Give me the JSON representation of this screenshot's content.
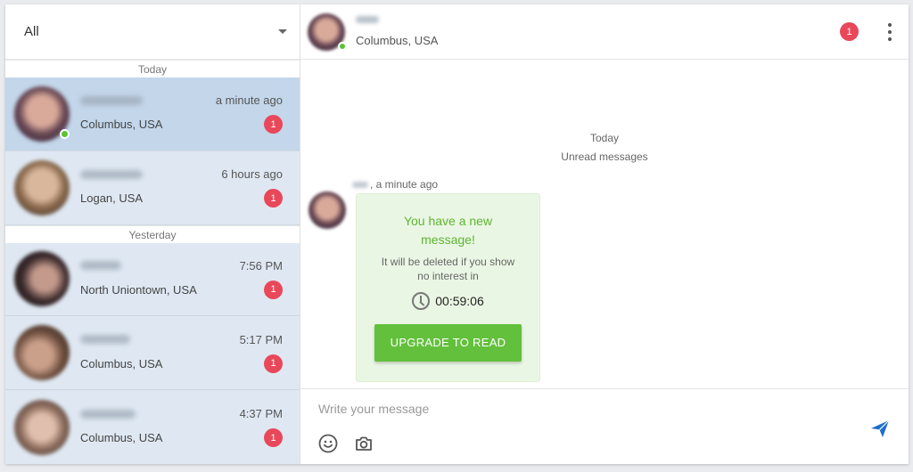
{
  "sidebar": {
    "filter": {
      "value": "All"
    },
    "sections": [
      {
        "label": "Today"
      },
      {
        "label": "Yesterday"
      }
    ],
    "conversations": [
      {
        "time": "a minute ago",
        "location": "Columbus, USA",
        "unread": "1",
        "online": true,
        "avatar_color": "#8a6470"
      },
      {
        "time": "6 hours ago",
        "location": "Logan, USA",
        "unread": "1",
        "online": false,
        "avatar_color": "#7a6a58"
      },
      {
        "time": "7:56 PM",
        "location": "North Uniontown, USA",
        "unread": "1",
        "online": false,
        "avatar_color": "#3e2e30"
      },
      {
        "time": "5:17 PM",
        "location": "Columbus, USA",
        "unread": "1",
        "online": false,
        "avatar_color": "#6e5244"
      },
      {
        "time": "4:37 PM",
        "location": "Columbus, USA",
        "unread": "1",
        "online": false,
        "avatar_color": "#8f7060"
      }
    ]
  },
  "chat": {
    "header": {
      "location": "Columbus, USA",
      "unread": "1"
    },
    "day_label": "Today",
    "unread_label": "Unread messages",
    "message_time": ", a minute ago",
    "card": {
      "title": "You have a new message!",
      "subtitle": "It will be deleted if you show no interest in",
      "timer": "00:59:06",
      "cta": "UPGRADE TO READ"
    },
    "composer": {
      "placeholder": "Write your message"
    }
  },
  "colors": {
    "accent_green": "#63c03c",
    "badge_red": "#e9475a",
    "send_blue": "#1e6fc8",
    "online_green": "#5bc236"
  }
}
